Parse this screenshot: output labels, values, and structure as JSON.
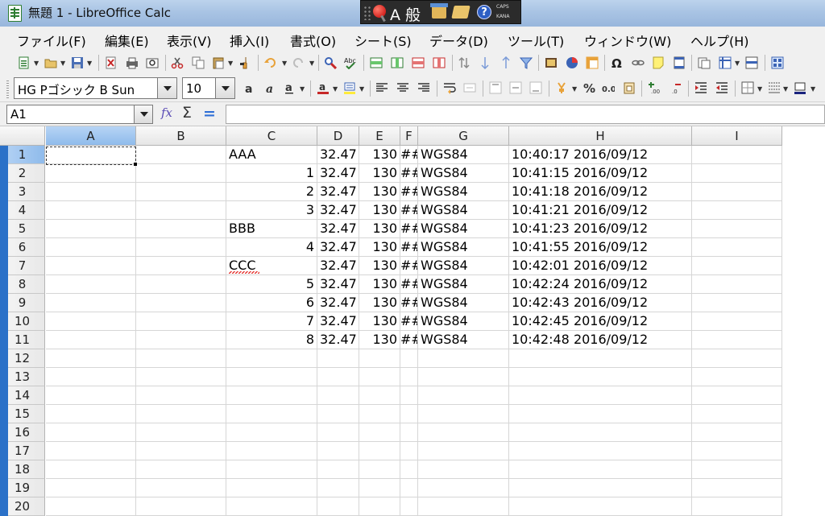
{
  "window": {
    "title": "無題 1 - LibreOffice Calc"
  },
  "ime": {
    "mode": "A 般",
    "help": "?",
    "caps": "CAPS",
    "kana": "KANA"
  },
  "menu": [
    "ファイル(F)",
    "編集(E)",
    "表示(V)",
    "挿入(I)",
    "書式(O)",
    "シート(S)",
    "データ(D)",
    "ツール(T)",
    "ウィンドウ(W)",
    "ヘルプ(H)"
  ],
  "format": {
    "font_name": "HG Pゴシック B Sun",
    "font_size": "10"
  },
  "formula_bar": {
    "name_box": "A1",
    "fx": "fx",
    "sum": "Σ",
    "equal": "=",
    "content": ""
  },
  "columns": [
    "A",
    "B",
    "C",
    "D",
    "E",
    "F",
    "G",
    "H",
    "I"
  ],
  "selected_column": "A",
  "selected_row": 1,
  "rows": [
    {
      "n": "1",
      "C": "AAA",
      "D": "32.47",
      "E": "130",
      "F": "##",
      "G": "WGS84",
      "H": "10:40:17 2016/09/12"
    },
    {
      "n": "2",
      "C": "1",
      "D": "32.47",
      "E": "130",
      "F": "##",
      "G": "WGS84",
      "H": "10:41:15 2016/09/12"
    },
    {
      "n": "3",
      "C": "2",
      "D": "32.47",
      "E": "130",
      "F": "##",
      "G": "WGS84",
      "H": "10:41:18 2016/09/12"
    },
    {
      "n": "4",
      "C": "3",
      "D": "32.47",
      "E": "130",
      "F": "##",
      "G": "WGS84",
      "H": "10:41:21 2016/09/12"
    },
    {
      "n": "5",
      "C": "BBB",
      "D": "32.47",
      "E": "130",
      "F": "##",
      "G": "WGS84",
      "H": "10:41:23 2016/09/12"
    },
    {
      "n": "6",
      "C": "4",
      "D": "32.47",
      "E": "130",
      "F": "##",
      "G": "WGS84",
      "H": "10:41:55 2016/09/12"
    },
    {
      "n": "7",
      "C": "CCC",
      "D": "32.47",
      "E": "130",
      "F": "##",
      "G": "WGS84",
      "H": "10:42:01 2016/09/12"
    },
    {
      "n": "8",
      "C": "5",
      "D": "32.47",
      "E": "130",
      "F": "##",
      "G": "WGS84",
      "H": "10:42:24 2016/09/12"
    },
    {
      "n": "9",
      "C": "6",
      "D": "32.47",
      "E": "130",
      "F": "##",
      "G": "WGS84",
      "H": "10:42:43 2016/09/12"
    },
    {
      "n": "10",
      "C": "7",
      "D": "32.47",
      "E": "130",
      "F": "##",
      "G": "WGS84",
      "H": "10:42:45 2016/09/12"
    },
    {
      "n": "11",
      "C": "8",
      "D": "32.47",
      "E": "130",
      "F": "##",
      "G": "WGS84",
      "H": "10:42:48 2016/09/12"
    },
    {
      "n": "12"
    },
    {
      "n": "13"
    },
    {
      "n": "14"
    },
    {
      "n": "15"
    },
    {
      "n": "16"
    },
    {
      "n": "17"
    },
    {
      "n": "18"
    },
    {
      "n": "19"
    },
    {
      "n": "20"
    }
  ],
  "numeric_columns": [
    "D",
    "E"
  ],
  "colors": {
    "selection": "#8fbbeb",
    "row_strip": "#2b71c8",
    "spell_error": "#e53935"
  }
}
